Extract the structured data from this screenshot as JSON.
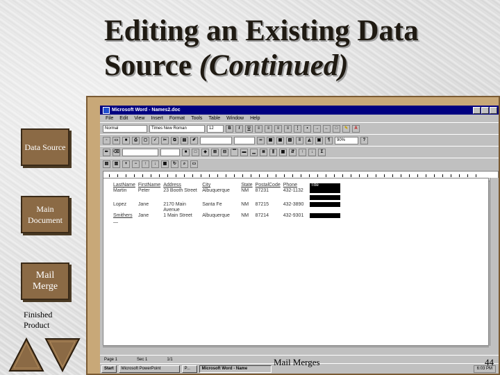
{
  "slide": {
    "title_line1": "Editing an Existing Data",
    "title_line2": "Source (Continued)",
    "title_line2_plain": "Source ",
    "title_line2_italic": "(Continued)",
    "footer": "Mail Merges",
    "page_number": "44"
  },
  "nav": {
    "data_source": "Data Source",
    "main_document": "Main Document",
    "mail_merge": "Mail Merge",
    "finished_product": "Finished Product"
  },
  "word": {
    "window_title": "Microsoft Word - Names2.doc",
    "menu": [
      "File",
      "Edit",
      "View",
      "Insert",
      "Format",
      "Tools",
      "Table",
      "Window",
      "Help"
    ],
    "style": "Normal",
    "font": "Times New Roman",
    "size": "12",
    "zoom": "90%",
    "table": {
      "headers": [
        "LastName",
        "FirstName",
        "Address",
        "City",
        "State",
        "PostalCode",
        "Phone",
        "Title"
      ],
      "rows": [
        [
          "Martin",
          "Peter",
          "23 Booth Street",
          "Albuquerque",
          "NM",
          "87231",
          "432-1132",
          ""
        ],
        [
          "Lopez",
          "Jane",
          "2170 Main Avenue",
          "Santa Fe",
          "NM",
          "87215",
          "432-3890",
          ""
        ],
        [
          "Smithers",
          "Jane",
          "1 Main Street",
          "Albuquerque",
          "NM",
          "87214",
          "432-9301",
          ""
        ]
      ]
    },
    "status": {
      "page": "Page 1",
      "sec": "Sec 1",
      "of": "1/1"
    },
    "taskbar": {
      "start": "Start",
      "items": [
        "Microsoft PowerPoint",
        "P...",
        "Microsoft Word - Name"
      ],
      "clock": "6:03 PM"
    }
  }
}
